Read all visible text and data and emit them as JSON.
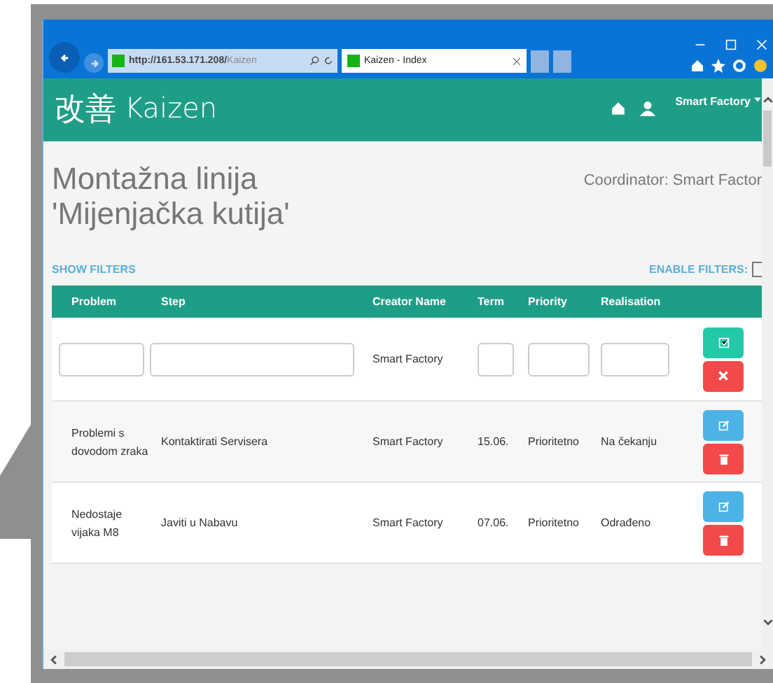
{
  "browser": {
    "address_host": "http://161.53.171.208/",
    "address_path": "Kaizen",
    "tab_title": "Kaizen - Index"
  },
  "header": {
    "logo_cjk": "改善",
    "logo_text": "Kaizen",
    "user": "Smart Factory"
  },
  "page": {
    "title_lines": [
      "Montažna linija",
      "'Mijenjačka kutija'"
    ],
    "coordinator": "Coordinator: Smart Factor",
    "show_filters": "SHOW FILTERS",
    "enable_filters": "ENABLE FILTERS:",
    "filters_enabled": false
  },
  "table": {
    "columns": [
      "Problem",
      "Step",
      "Creator Name",
      "Term",
      "Priority",
      "Realisation"
    ],
    "new_row": {
      "creator": "Smart Factory"
    },
    "rows": [
      {
        "problem": "Problemi s dovodom zraka",
        "step": "Kontaktirati Servisera",
        "creator": "Smart Factory",
        "term": "15.06.",
        "priority": "Prioritetno",
        "realisation": "Na čekanju"
      },
      {
        "problem": "Nedostaje vijaka M8",
        "step": "Javiti u Nabavu",
        "creator": "Smart Factory",
        "term": "07.06.",
        "priority": "Prioritetno",
        "realisation": "Odrađeno"
      }
    ]
  }
}
